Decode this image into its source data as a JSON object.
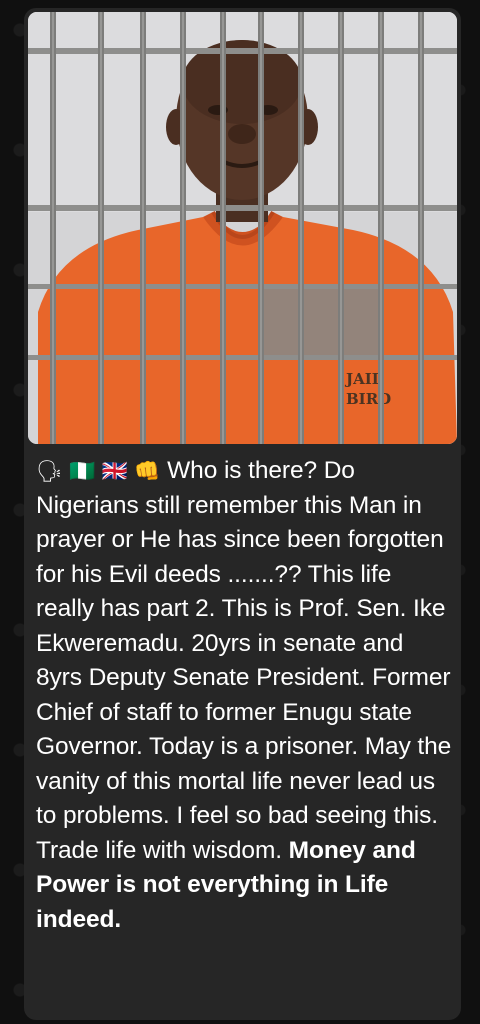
{
  "post": {
    "emojis": "🗣 🇳🇬 🇬🇧 👊",
    "body_text": "Who is there? Do Nigerians still remember this Man in prayer or He has since been forgotten for his Evil deeds .......??  This life really has part 2.  This is Prof. Sen. Ike Ekweremadu. 20yrs in senate and 8yrs Deputy Senate President. Former Chief of staff to former Enugu state Governor. Today is a prisoner.  May the vanity of this mortal life never lead us to problems. I feel so bad seeing this. Trade life with wisdom. ",
    "bold_text": "Money and Power is not everything in Life indeed.",
    "image_text": "JAIL BIRD"
  },
  "colors": {
    "bubble": "#262626",
    "jumpsuit": "#e8662a",
    "bars": "#8e8e8c",
    "text": "#ffffff"
  }
}
